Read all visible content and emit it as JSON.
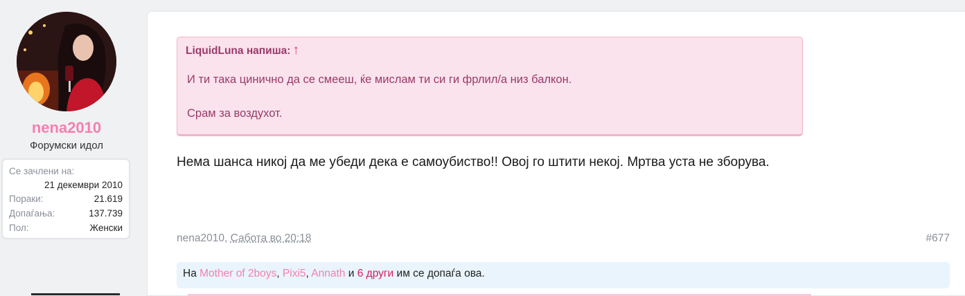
{
  "user": {
    "name": "nena2010",
    "title": "Форумски идол",
    "stats": [
      {
        "label": "Се зачлени на:",
        "value": "21 декември 2010"
      },
      {
        "label": "Пораки:",
        "value": "21.619"
      },
      {
        "label": "Допаѓања:",
        "value": "137.739"
      },
      {
        "label": "Пол:",
        "value": "Женски"
      }
    ]
  },
  "quote": {
    "author": "LiquidLuna напиша:",
    "arrow": "↑",
    "paragraphs": [
      "И ти така цинично да се смееш, ќе мислам ти си ги фрлил/а низ балкон.",
      "Срам за воздухот."
    ]
  },
  "message": "Нема шанса никој да ме убеди дека е самоубиство!! Овој го штити некој. Мртва уста не зборува.",
  "meta": {
    "author": "nena2010,",
    "date": "Сабота во 20:18",
    "post_number": "#677"
  },
  "likes": {
    "prefix": "На",
    "users": [
      "Mother of 2boys",
      "Pixi5",
      "Annath"
    ],
    "sep1": ",",
    "sep2": ",",
    "and": "и",
    "others": "6 други",
    "suffix": "им се допаѓа ова."
  },
  "colors": {
    "username": "#f47fb0",
    "quote_bg": "#fae3ec",
    "quote_text": "#9a3a6a",
    "likes_bg": "#e9f4fc",
    "link": "#f47fb0",
    "others_link": "#d81b60"
  }
}
